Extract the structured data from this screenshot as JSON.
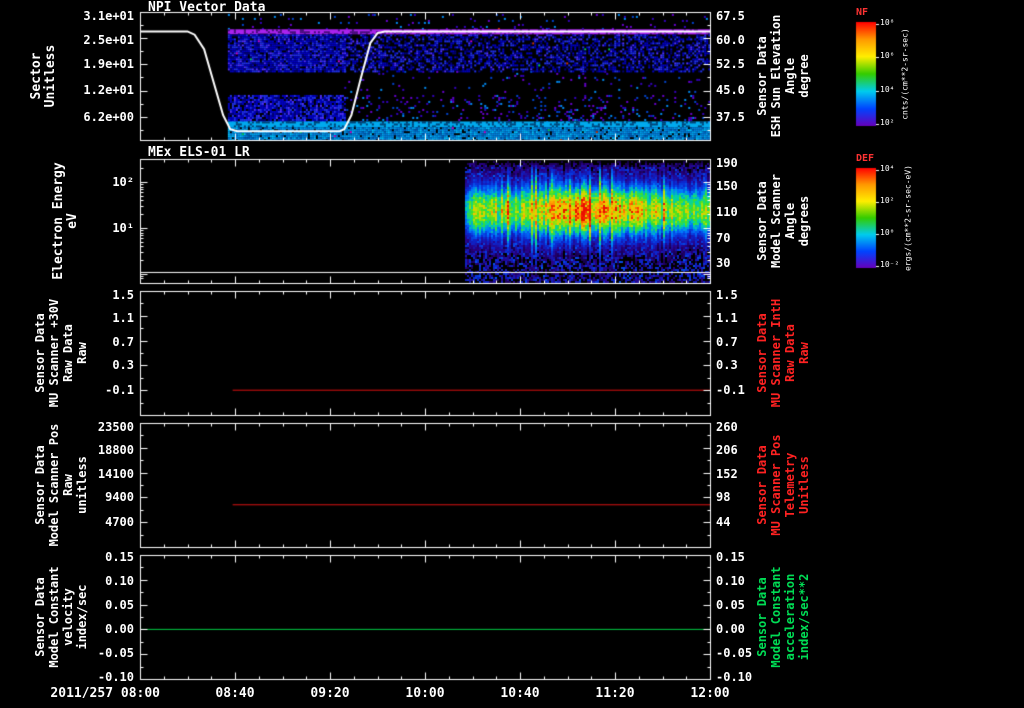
{
  "window": {
    "bg": "#000000"
  },
  "x_axis": {
    "date_label": "2011/257 08:00",
    "t_start_min": 0,
    "t_end_min": 240,
    "minor_step_min": 10,
    "ticks": [
      {
        "label": "08:40",
        "min": 40
      },
      {
        "label": "09:20",
        "min": 80
      },
      {
        "label": "10:00",
        "min": 120
      },
      {
        "label": "10:40",
        "min": 160
      },
      {
        "label": "11:20",
        "min": 200
      },
      {
        "label": "12:00",
        "min": 240
      }
    ]
  },
  "chart_data": [
    {
      "id": "p1",
      "type": "heatmap",
      "title": "NPI Vector Data",
      "left_title_lines": [
        "Sector",
        "Unitless"
      ],
      "right_title_lines": [
        "Sensor Data",
        "ESH Sun Elevation",
        "Angle",
        "degree"
      ],
      "right_title_color": "#ffffff",
      "y_left_range": [
        0,
        31
      ],
      "left_tick_labels": [
        {
          "label": "3.1e+01",
          "frac": 0.03
        },
        {
          "label": "2.5e+01",
          "frac": 0.215
        },
        {
          "label": "1.9e+01",
          "frac": 0.41
        },
        {
          "label": "1.2e+01",
          "frac": 0.61
        },
        {
          "label": "6.2e+00",
          "frac": 0.82
        }
      ],
      "right_tick_labels": [
        {
          "label": "67.5",
          "frac": 0.03
        },
        {
          "label": "60.0",
          "frac": 0.215
        },
        {
          "label": "52.5",
          "frac": 0.41
        },
        {
          "label": "45.0",
          "frac": 0.61
        },
        {
          "label": "37.5",
          "frac": 0.82
        }
      ],
      "y_major_fracs": [
        0,
        0.205,
        0.41,
        0.615,
        0.82
      ],
      "y_minor_fracs": [
        0.1,
        0.305,
        0.51,
        0.715,
        0.92
      ],
      "overlay_line": {
        "color": "#ffffff",
        "width": 2,
        "y_top_value": 31,
        "y_bottom_value": 0,
        "points": [
          [
            0,
            26.3
          ],
          [
            20,
            26.3
          ],
          [
            23,
            25.5
          ],
          [
            27,
            22
          ],
          [
            31,
            14
          ],
          [
            35,
            6
          ],
          [
            38,
            2.6
          ],
          [
            41,
            2.1
          ],
          [
            84,
            2.1
          ],
          [
            86,
            2.6
          ],
          [
            89,
            6
          ],
          [
            93,
            15
          ],
          [
            97,
            23.5
          ],
          [
            100,
            25.9
          ],
          [
            103,
            26.3
          ],
          [
            240,
            26.3
          ]
        ]
      },
      "bands": [
        {
          "t0": 37,
          "t1": 240,
          "f0": 0.015,
          "f1": 0.135,
          "style": "sparse",
          "density": 0.055
        },
        {
          "t0": 37,
          "t1": 240,
          "f0": 0.135,
          "f1": 0.175,
          "style": "solid",
          "color": "#aa22ee",
          "noise": 0.25
        },
        {
          "t0": 37,
          "t1": 86,
          "f0": 0.175,
          "f1": 0.46,
          "style": "dense",
          "density": 0.88
        },
        {
          "t0": 86,
          "t1": 240,
          "f0": 0.175,
          "f1": 0.46,
          "style": "dense",
          "density": 0.5
        },
        {
          "t0": 86,
          "t1": 240,
          "f0": 0.46,
          "f1": 0.63,
          "style": "sparse",
          "density": 0.05
        },
        {
          "t0": 37,
          "t1": 86,
          "f0": 0.648,
          "f1": 0.855,
          "style": "dense",
          "density": 0.82
        },
        {
          "t0": 86,
          "t1": 240,
          "f0": 0.648,
          "f1": 0.855,
          "style": "sparse",
          "density": 0.13
        },
        {
          "t0": 37,
          "t1": 240,
          "f0": 0.855,
          "f1": 0.9,
          "style": "solid",
          "color": "#00aaee",
          "noise": 0.3
        },
        {
          "t0": 37,
          "t1": 240,
          "f0": 0.9,
          "f1": 0.995,
          "style": "dense",
          "density": 0.92,
          "palette": "cyan"
        }
      ],
      "colorbar": {
        "label": "NF",
        "label_color": "#ff3333",
        "unit": "cnts/(cm**2-sr-sec)",
        "colors": [
          "#ff0000",
          "#ff9900",
          "#ffee00",
          "#33cc00",
          "#00ccee",
          "#0044ff",
          "#6600bb"
        ],
        "ticks": [
          {
            "label": "10⁸",
            "frac": 0.02
          },
          {
            "label": "10⁶",
            "frac": 0.34
          },
          {
            "label": "10⁴",
            "frac": 0.66
          },
          {
            "label": "10²",
            "frac": 0.98
          }
        ]
      }
    },
    {
      "id": "p2",
      "type": "heatmap",
      "title": "MEx ELS-01 LR",
      "left_title_lines": [
        "Electron Energy",
        "eV"
      ],
      "right_title_lines": [
        "Sensor Data",
        "Model Scanner",
        "Angle",
        "degrees"
      ],
      "right_title_color": "#ffffff",
      "left_tick_labels": [
        {
          "label": "10²",
          "frac": 0.185
        },
        {
          "label": "10¹",
          "frac": 0.556
        }
      ],
      "right_tick_labels": [
        {
          "label": "190",
          "frac": 0.03
        },
        {
          "label": "150",
          "frac": 0.22
        },
        {
          "label": "110",
          "frac": 0.43
        },
        {
          "label": "70",
          "frac": 0.64
        },
        {
          "label": "30",
          "frac": 0.84
        }
      ],
      "y_major_fracs": [
        0.185,
        0.556,
        0.927
      ],
      "y_minor_fracs": [
        0.074,
        0.203,
        0.222,
        0.243,
        0.268,
        0.297,
        0.333,
        0.38,
        0.445,
        0.574,
        0.593,
        0.614,
        0.639,
        0.668,
        0.704,
        0.751,
        0.816,
        0.944,
        0.963
      ],
      "overlay_line": {
        "color": "#ffffff",
        "width": 1,
        "y_frac": true,
        "points": [
          [
            0,
            0.915
          ],
          [
            240,
            0.915
          ]
        ]
      },
      "blob": {
        "t0": 137,
        "t1": 240,
        "center_frac": 0.41,
        "sigma_frac": 0.155,
        "bg_density": 0.6,
        "amp_profile": [
          [
            137,
            0.5
          ],
          [
            140,
            0.68
          ],
          [
            150,
            0.72
          ],
          [
            160,
            0.7
          ],
          [
            168,
            0.74
          ],
          [
            175,
            0.9
          ],
          [
            180,
            0.85
          ],
          [
            186,
            0.95
          ],
          [
            192,
            0.9
          ],
          [
            199,
            0.85
          ],
          [
            207,
            0.8
          ],
          [
            215,
            0.74
          ],
          [
            228,
            0.72
          ],
          [
            240,
            0.68
          ]
        ]
      },
      "colorbar": {
        "label": "DEF",
        "label_color": "#ff3333",
        "unit": "ergs/(cm**2-sr-sec-eV)",
        "colors": [
          "#ff0000",
          "#ff9900",
          "#ffee00",
          "#33cc00",
          "#00ccee",
          "#0044ff",
          "#6600bb"
        ],
        "ticks": [
          {
            "label": "10⁴",
            "frac": 0.02
          },
          {
            "label": "10²",
            "frac": 0.34
          },
          {
            "label": "10⁰",
            "frac": 0.66
          },
          {
            "label": "10⁻²",
            "frac": 0.98
          }
        ]
      }
    },
    {
      "id": "p3",
      "type": "line",
      "left_title_lines": [
        "Sensor Data",
        "MU Scanner +30V",
        "Raw Data",
        "Raw"
      ],
      "right_title_lines": [
        "Sensor Data",
        "MU Scanner IntH",
        "Raw Data",
        "Raw"
      ],
      "right_title_color": "#ff2222",
      "y_range": [
        -0.5,
        1.5
      ],
      "left_tick_labels": [
        {
          "label": "1.5",
          "frac": 0.03
        },
        {
          "label": "1.1",
          "frac": 0.215
        },
        {
          "label": "0.7",
          "frac": 0.41
        },
        {
          "label": "0.3",
          "frac": 0.6
        },
        {
          "label": "-0.1",
          "frac": 0.795
        }
      ],
      "right_tick_labels": [
        {
          "label": "1.5",
          "frac": 0.03
        },
        {
          "label": "1.1",
          "frac": 0.215
        },
        {
          "label": "0.7",
          "frac": 0.41
        },
        {
          "label": "0.3",
          "frac": 0.6
        },
        {
          "label": "-0.1",
          "frac": 0.795
        }
      ],
      "y_major_fracs": [
        0,
        0.2,
        0.4,
        0.6,
        0.8
      ],
      "y_minor_fracs": [
        0.1,
        0.3,
        0.5,
        0.7,
        0.9
      ],
      "series": [
        {
          "color": "#dd1111",
          "width": 1,
          "y_top_value": 1.5,
          "y_bottom_value": -0.5,
          "points": [
            [
              39,
              -0.1
            ],
            [
              240,
              -0.1
            ]
          ]
        }
      ]
    },
    {
      "id": "p4",
      "type": "line",
      "left_title_lines": [
        "Sensor Data",
        "Model Scanner Pos",
        "Raw",
        "unitless"
      ],
      "right_title_lines": [
        "Sensor Data",
        "MU Scanner Pos",
        "Telemetry",
        "Unitless"
      ],
      "right_title_color": "#ff2222",
      "y_range": [
        0,
        23500
      ],
      "left_tick_labels": [
        {
          "label": "23500",
          "frac": 0.03
        },
        {
          "label": "18800",
          "frac": 0.215
        },
        {
          "label": "14100",
          "frac": 0.41
        },
        {
          "label": "9400",
          "frac": 0.6
        },
        {
          "label": "4700",
          "frac": 0.795
        }
      ],
      "right_tick_labels": [
        {
          "label": "260",
          "frac": 0.03
        },
        {
          "label": "206",
          "frac": 0.215
        },
        {
          "label": "152",
          "frac": 0.41
        },
        {
          "label": "98",
          "frac": 0.6
        },
        {
          "label": "44",
          "frac": 0.795
        }
      ],
      "y_major_fracs": [
        0,
        0.2,
        0.4,
        0.6,
        0.8
      ],
      "y_minor_fracs": [
        0.1,
        0.3,
        0.5,
        0.7,
        0.9
      ],
      "series": [
        {
          "color": "#dd1111",
          "width": 1,
          "y_top_value": 23500,
          "y_bottom_value": 0,
          "points": [
            [
              39,
              8000
            ],
            [
              240,
              8000
            ]
          ]
        }
      ]
    },
    {
      "id": "p5",
      "type": "line",
      "left_title_lines": [
        "Sensor Data",
        "Model Constant",
        "velocity",
        "index/sec"
      ],
      "right_title_lines": [
        "Sensor Data",
        "Model Constant",
        "acceleration",
        "index/sec**2"
      ],
      "right_title_color": "#00dd55",
      "y_range": [
        -0.1,
        0.15
      ],
      "left_tick_labels": [
        {
          "label": "0.15",
          "frac": 0.02
        },
        {
          "label": "0.10",
          "frac": 0.21
        },
        {
          "label": "0.05",
          "frac": 0.4
        },
        {
          "label": "0.00",
          "frac": 0.595
        },
        {
          "label": "-0.05",
          "frac": 0.79
        },
        {
          "label": "-0.10",
          "frac": 0.985
        }
      ],
      "right_tick_labels": [
        {
          "label": "0.15",
          "frac": 0.02
        },
        {
          "label": "0.10",
          "frac": 0.21
        },
        {
          "label": "0.05",
          "frac": 0.4
        },
        {
          "label": "0.00",
          "frac": 0.595
        },
        {
          "label": "-0.05",
          "frac": 0.79
        },
        {
          "label": "-0.10",
          "frac": 0.985
        }
      ],
      "y_major_fracs": [
        0,
        0.2,
        0.4,
        0.6,
        0.8,
        1.0
      ],
      "y_minor_fracs": [
        0.1,
        0.3,
        0.5,
        0.7,
        0.9
      ],
      "series": [
        {
          "color": "#00cc44",
          "width": 1,
          "y_top_value": 0.15,
          "y_bottom_value": -0.1,
          "points": [
            [
              0,
              0.0
            ],
            [
              240,
              0.0
            ]
          ]
        }
      ]
    }
  ]
}
